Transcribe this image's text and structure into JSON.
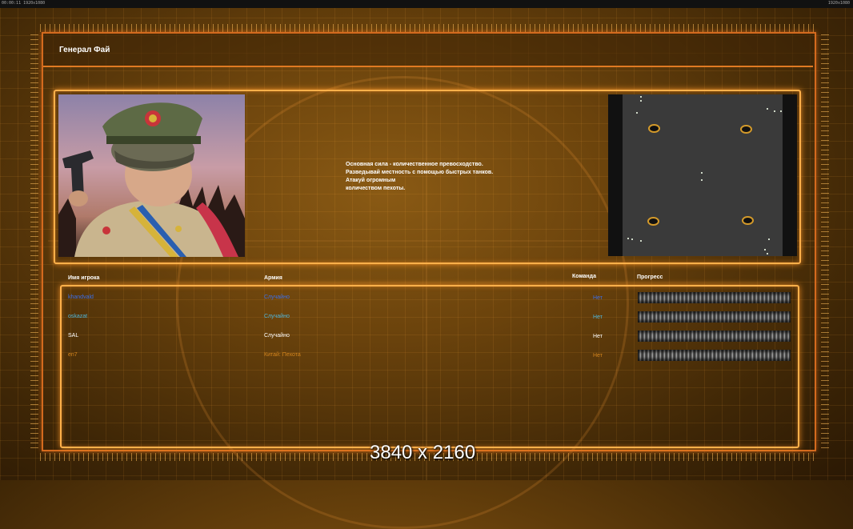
{
  "window": {
    "title_bar": "00:00:11 1920x1080",
    "corner_badge": "1920x1080"
  },
  "header": {
    "title": "Генерал Фай"
  },
  "general": {
    "portrait_alt": "General Fai portrait",
    "description": [
      "Основная сила - количественное превосходство.",
      "Разведывай местность с помощью быстрых танков.",
      "Атакуй огромным",
      "количеством пехоты."
    ]
  },
  "table": {
    "headers": {
      "player": "Имя игрока",
      "army": "Армия",
      "team": "Команда",
      "progress": "Прогресс"
    },
    "rows": [
      {
        "player": "khandvald",
        "army": "Случайно",
        "team": "Нет",
        "player_color": "#3b6ee8",
        "army_color": "#3b6ee8",
        "team_color": "#3b6ee8"
      },
      {
        "player": "oskazat",
        "army": "Случайно",
        "team": "Нет",
        "player_color": "#4fb4d8",
        "army_color": "#4fb4d8",
        "team_color": "#4fb4d8"
      },
      {
        "player": "SAL",
        "army": "Случайно",
        "team": "Нет",
        "player_color": "#ffffff",
        "army_color": "#ffffff",
        "team_color": "#ffffff"
      },
      {
        "player": "en7",
        "army": "Китай: Пехота",
        "team": "Нет",
        "player_color": "#d4851e",
        "army_color": "#d4851e",
        "team_color": "#d4851e"
      }
    ]
  },
  "overlay": {
    "resolution": "3840 x 2160"
  },
  "colors": {
    "frame": "#d46a1e",
    "panel_glow": "#ffb04a",
    "accent": "#d49a2a"
  }
}
